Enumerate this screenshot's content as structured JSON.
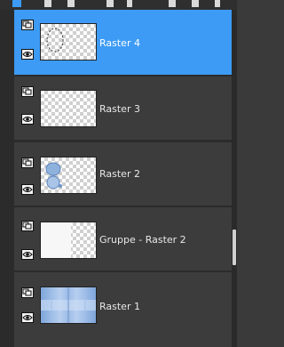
{
  "panel": {
    "layers": [
      {
        "name": "Raster 4",
        "selected": true
      },
      {
        "name": "Raster 3",
        "selected": false
      },
      {
        "name": "Raster 2",
        "selected": false
      },
      {
        "name": "Gruppe - Raster 2",
        "selected": false
      },
      {
        "name": "Raster 1",
        "selected": false
      }
    ]
  },
  "icons": {
    "layer_type": "layer-stack-icon",
    "visibility": "eye-icon"
  },
  "colors": {
    "selected_row": "#3d9bf5",
    "row_bg": "#3c3c3c",
    "panel_bg": "#2b2b2b"
  }
}
